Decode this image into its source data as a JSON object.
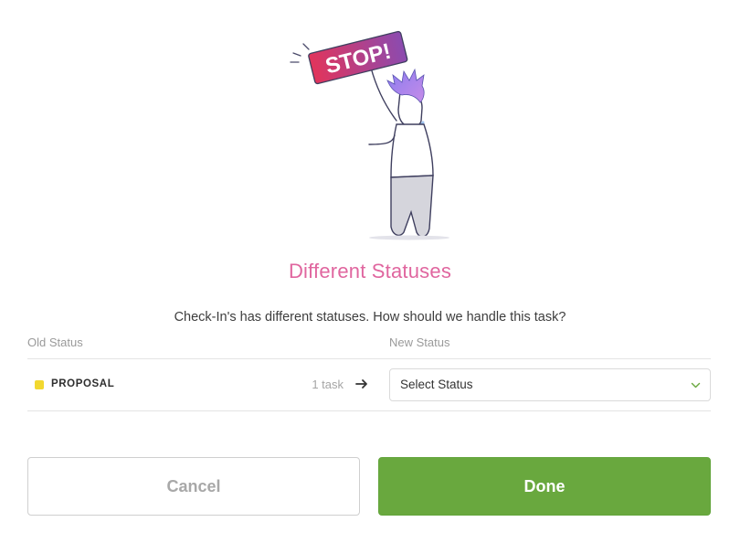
{
  "illustration": {
    "sign_text": "STOP!",
    "sign_colors": [
      "#e2345b",
      "#8b4bb0"
    ]
  },
  "dialog": {
    "title": "Different Statuses",
    "description": "Check-In's has different statuses. How should we handle this task?",
    "title_color": "#e0669f"
  },
  "table": {
    "old_status_header": "Old Status",
    "new_status_header": "New Status",
    "rows": [
      {
        "status_name": "PROPOSAL",
        "status_color": "#f2d82f",
        "task_count": "1 task",
        "arrow_icon": "arrow-right-icon",
        "select_value": "Select Status",
        "select_icon": "chevron-down-icon"
      }
    ]
  },
  "buttons": {
    "cancel_label": "Cancel",
    "done_label": "Done",
    "done_color": "#69a83e"
  }
}
